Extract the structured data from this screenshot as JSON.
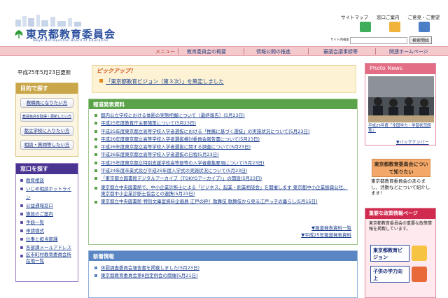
{
  "header": {
    "logo_text": "東京都教育委員会",
    "logo_subtitle": "Tokyo Metropolitan Board of Education",
    "top_links": [
      "サイトマップ",
      "窓口ご案内",
      "ご意見・ご要望"
    ],
    "search_label": "サイト内検索",
    "search_button": "検索開始",
    "search_value": ""
  },
  "nav": {
    "items": [
      "メニュー",
      "教育委員会の概要",
      "情報公開の推進",
      "審議会議事録等",
      "関連ホームページ"
    ]
  },
  "left": {
    "updated": "平成25年5月23日更新",
    "purpose": {
      "title": "目的で探す",
      "buttons": [
        "教職員になりたい方",
        "教員免許を取得・更新したい方",
        "都立学校に入りたい方",
        "相談・質問等したい方"
      ]
    },
    "window": {
      "title": "窓口を探す",
      "items": [
        "教育相談",
        "いじめ相談ホットライン",
        "公益通報窓口",
        "施設のご案内",
        "手続一覧",
        "申請様式",
        "仕事と担当部課",
        "各部課メールアドレス",
        "区市町村教育委員会所在地一覧"
      ]
    }
  },
  "center": {
    "pickup": {
      "title": "ピックアップ！",
      "item": "「東京都教育ビジョン（第３次）」を策定しました"
    },
    "press": {
      "title": "報道発表資料",
      "items": [
        "都内公立学校における体罰の実態把握について（最終報告）(5月23日)",
        "平成25年度教育庁主要施策について(5月23日)",
        "平成25年度東京都立高等学校入学者選抜における「推薦に基づく選抜」の実施状況について(5月23日)",
        "平成26年度東京都立高等学校入学者選抜検討委員会報告書について(5月23日)",
        "平成26年度東京都立高等学校入学者選抜に関する調査について(5月23日)",
        "平成26年度東京都立高等学校入学者選抜の日程(5月23日)",
        "平成25年度東京都立特別支援学校高等部等の入学者募集要項について(5月23日)",
        "平成24年度卒業式及び平成25年度入学式の実施状況について(5月23日)",
        "「東京都立図書館デジタルアーカイブ（TOKYOアーカイブ）」の開設(5月23日)",
        "東京都立中央図書館で、中小企業診断士による「ビジネス、起業・創業相談会」を開催します 東京都中小企業振興公社、東京都中小企業診断士協会との連携(5月23日)",
        "東京都立中央図書館 特別文庫室資料企画展 江戸の粋！歌舞伎 歌舞伎から見る江戸っ子の暮らし(5月15日)"
      ],
      "more_links": [
        "▼報道発表資料一覧",
        "▼平成25年報道発表資料"
      ]
    },
    "news": {
      "title": "新着情報",
      "items": [
        "体罰調査委員会報告書を掲載しました(5月23日)",
        "東京都教育委員会第8回定例会の開催(5月21日)"
      ]
    }
  },
  "right": {
    "photo_news": {
      "title": "Photo News",
      "caption": "平成25年度「全国学力・学習状況調査」",
      "backnumber": "▼バックナンバー"
    },
    "about": {
      "banner": "東京都教育委員会について知りたい",
      "text": "東京都教育委員会のあらまし、活動などについて紹介します！"
    },
    "policy": {
      "title": "重要な政策情報ページ",
      "text": "東京都教育委員会の重要な政策情報を掲載しています。",
      "buttons": [
        "東京都教育ビジョン",
        "子供の学力向上"
      ]
    }
  },
  "colors": {
    "nav_bg": "#f4c9cd",
    "press_green": "#5aa34a",
    "news_blue": "#5a86c3",
    "window_purple": "#4a3492",
    "policy_red": "#d02a4e"
  }
}
